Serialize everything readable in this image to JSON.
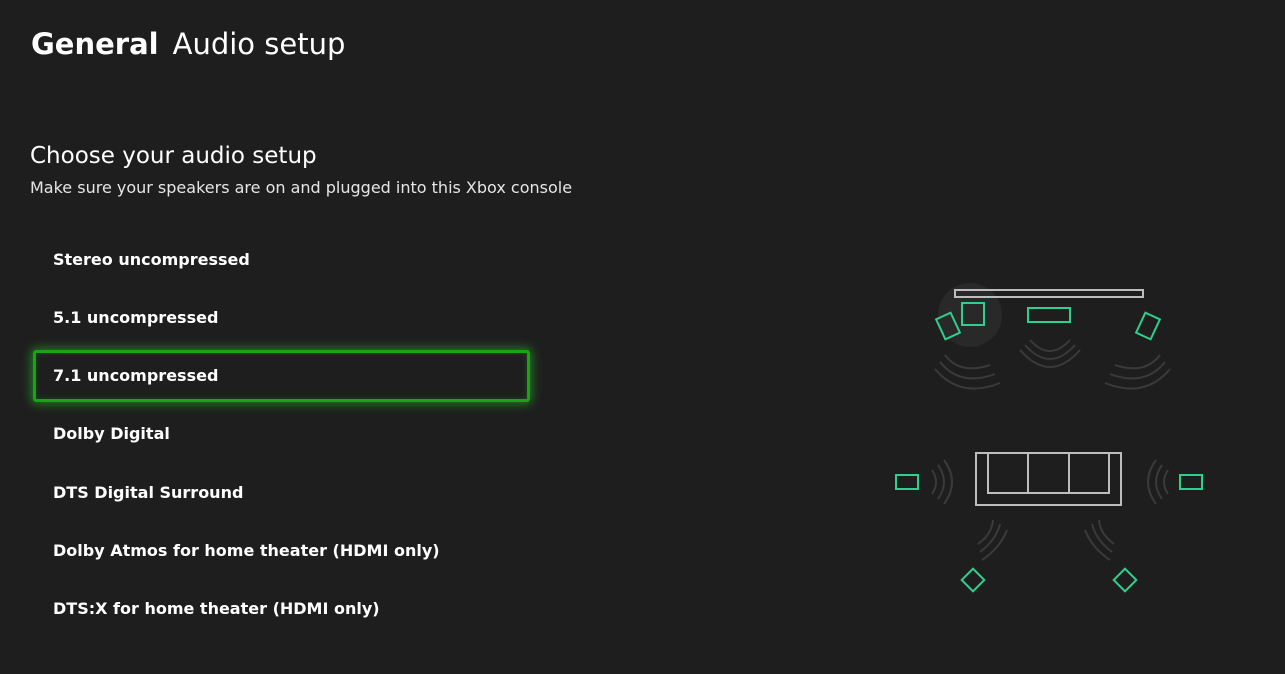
{
  "header": {
    "breadcrumb": "General",
    "title": "Audio setup"
  },
  "section": {
    "title": "Choose your audio setup",
    "subtitle": "Make sure your speakers are on and plugged into this Xbox console"
  },
  "options": [
    {
      "label": "Stereo uncompressed",
      "focused": false
    },
    {
      "label": "5.1 uncompressed",
      "focused": false
    },
    {
      "label": "7.1 uncompressed",
      "focused": true
    },
    {
      "label": "Dolby Digital",
      "focused": false
    },
    {
      "label": "DTS Digital Surround",
      "focused": false
    },
    {
      "label": "Dolby Atmos for home theater (HDMI only)",
      "focused": false
    },
    {
      "label": "DTS:X for home theater (HDMI only)",
      "focused": false
    }
  ],
  "colors": {
    "background": "#1e1e1e",
    "focus_accent": "#18a413",
    "speaker": "#2ecf8f",
    "diagram_line": "#bdbdbd"
  },
  "diagram": {
    "speakers": [
      "front-left",
      "center",
      "front-right",
      "side-left",
      "side-right",
      "rear-left",
      "rear-right",
      "subwoofer"
    ],
    "furniture": [
      "tv",
      "sofa"
    ]
  }
}
